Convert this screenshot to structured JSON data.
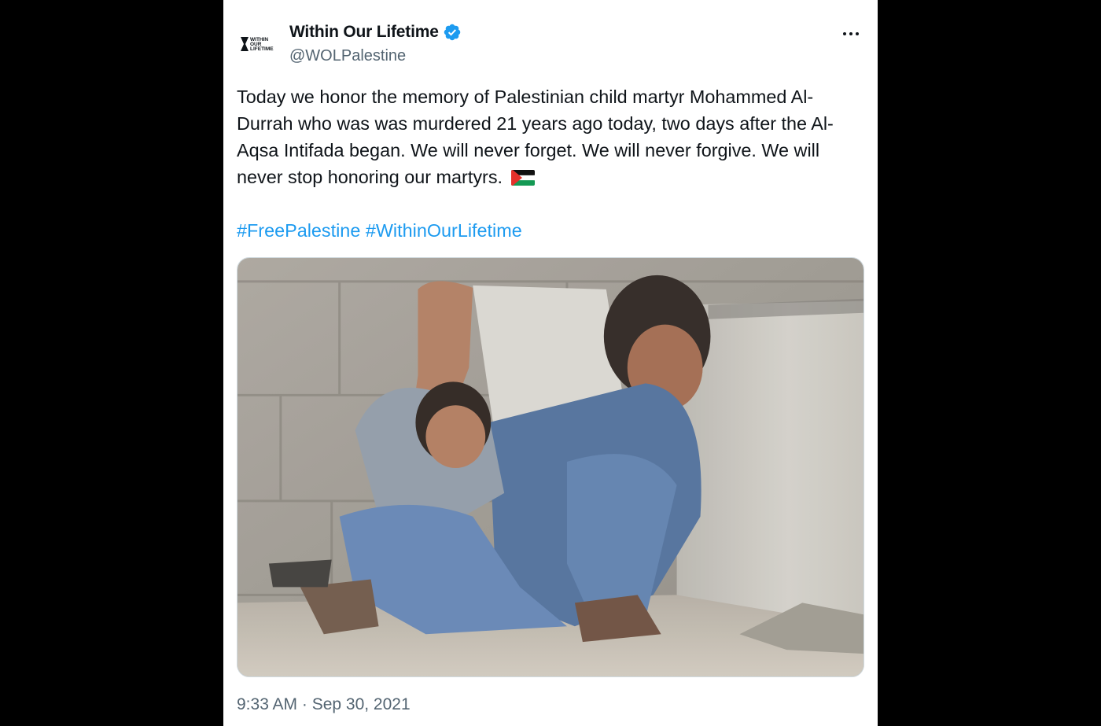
{
  "tweet": {
    "author_name": "Within Our Lifetime",
    "author_handle": "@WOLPalestine",
    "verified_icon": "verified-badge-icon",
    "avatar_text": [
      "WITHIN",
      "OUR",
      "LIFETIME"
    ],
    "text": "Today we honor the memory of Palestinian child martyr Mohammed Al-Durrah who was was murdered 21 years ago today, two days after the Al-Aqsa Intifada began. We will never forget. We will never forgive. We will never stop honoring our martyrs.",
    "emoji": "palestine-flag-icon",
    "hashtags": [
      "#FreePalestine",
      "#WithinOurLifetime"
    ],
    "timestamp": "9:33 AM · Sep 30, 2021",
    "more_icon": "more-options-icon"
  },
  "colors": {
    "page_background": "#000000",
    "card_background": "#ffffff",
    "text_primary": "#0f1419",
    "text_secondary": "#536471",
    "link": "#1d9bf0",
    "verified": "#1d9bf0"
  }
}
